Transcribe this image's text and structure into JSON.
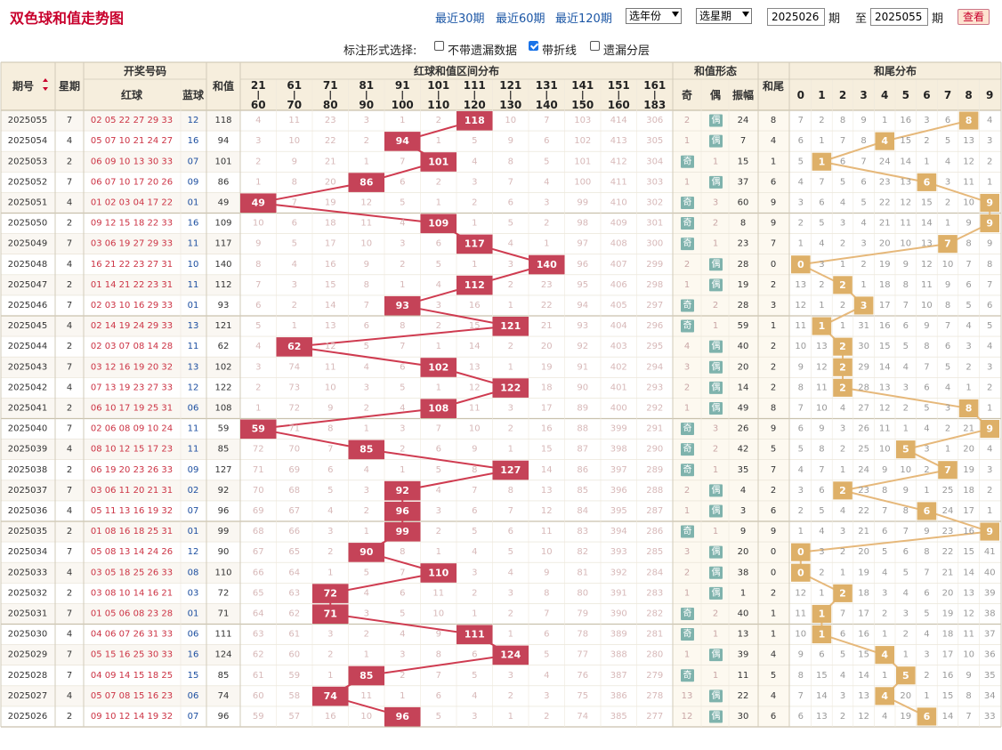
{
  "title": "双色球和值走势图",
  "ranges": [
    {
      "label": "最近30期",
      "active": true
    },
    {
      "label": "最近60期",
      "active": false
    },
    {
      "label": "最近120期",
      "active": false
    }
  ],
  "year_select": "选年份",
  "period_select": "选星期",
  "from_value": "2025026",
  "period_label": "期",
  "to_label": "至",
  "to_value": "2025055",
  "query_label": "查看",
  "options": {
    "label": "标注形式选择:",
    "items": [
      {
        "label": "不带遗漏数据",
        "checked": false
      },
      {
        "label": "带折线",
        "checked": true
      },
      {
        "label": "遗漏分层",
        "checked": false
      }
    ]
  },
  "headers": {
    "issue": "期号",
    "weekday": "星期",
    "draw": "开奖号码",
    "red": "红球",
    "blue": "蓝球",
    "sum": "和值",
    "range_dist": "红球和值区间分布",
    "form": "和值形态",
    "odd": "奇",
    "even": "偶",
    "amplitude": "振幅",
    "tail": "和尾",
    "tail_dist": "和尾分布"
  },
  "ranges_bins": [
    {
      "top": "21",
      "bottom": "60"
    },
    {
      "top": "61",
      "bottom": "70"
    },
    {
      "top": "71",
      "bottom": "80"
    },
    {
      "top": "81",
      "bottom": "90"
    },
    {
      "top": "91",
      "bottom": "100"
    },
    {
      "top": "101",
      "bottom": "110"
    },
    {
      "top": "111",
      "bottom": "120"
    },
    {
      "top": "121",
      "bottom": "130"
    },
    {
      "top": "131",
      "bottom": "140"
    },
    {
      "top": "141",
      "bottom": "150"
    },
    {
      "top": "151",
      "bottom": "160"
    },
    {
      "top": "161",
      "bottom": "183"
    }
  ],
  "tail_digits": [
    "0",
    "1",
    "2",
    "3",
    "4",
    "5",
    "6",
    "7",
    "8",
    "9"
  ],
  "odd_word": "奇",
  "even_word": "偶",
  "colors": {
    "red": "#cc3344",
    "blue": "#1d4fa0",
    "hit_red": "#c54358",
    "hit_tail": "#deb068",
    "line_red": "#cf3b50",
    "line_tail": "#e6b87a"
  },
  "rows": [
    {
      "issue": "2025055",
      "week": "7",
      "red": "02 05 22 27 29 33",
      "blue": "12",
      "sum": "118",
      "bins": [
        "4",
        "11",
        "23",
        "3",
        "1",
        "2",
        "118",
        "10",
        "7",
        "103",
        "414",
        "306"
      ],
      "odd": "2",
      "even": "偶",
      "amp": "24",
      "tail": "8",
      "tails": [
        "7",
        "2",
        "8",
        "9",
        "1",
        "16",
        "3",
        "6",
        "8",
        "4"
      ]
    },
    {
      "issue": "2025054",
      "week": "4",
      "red": "05 07 10 21 24 27",
      "blue": "16",
      "sum": "94",
      "bins": [
        "3",
        "10",
        "22",
        "2",
        "94",
        "1",
        "5",
        "9",
        "6",
        "102",
        "413",
        "305"
      ],
      "odd": "1",
      "even": "偶",
      "amp": "7",
      "tail": "4",
      "tails": [
        "6",
        "1",
        "7",
        "8",
        "4",
        "15",
        "2",
        "5",
        "13",
        "3"
      ]
    },
    {
      "issue": "2025053",
      "week": "2",
      "red": "06 09 10 13 30 33",
      "blue": "07",
      "sum": "101",
      "bins": [
        "2",
        "9",
        "21",
        "1",
        "7",
        "101",
        "4",
        "8",
        "5",
        "101",
        "412",
        "304"
      ],
      "odd": "奇",
      "even": "1",
      "amp": "15",
      "tail": "1",
      "tails": [
        "5",
        "1",
        "6",
        "7",
        "24",
        "14",
        "1",
        "4",
        "12",
        "2"
      ]
    },
    {
      "issue": "2025052",
      "week": "7",
      "red": "06 07 10 17 20 26",
      "blue": "09",
      "sum": "86",
      "bins": [
        "1",
        "8",
        "20",
        "86",
        "6",
        "2",
        "3",
        "7",
        "4",
        "100",
        "411",
        "303"
      ],
      "odd": "1",
      "even": "偶",
      "amp": "37",
      "tail": "6",
      "tails": [
        "4",
        "7",
        "5",
        "6",
        "23",
        "13",
        "6",
        "3",
        "11",
        "1"
      ]
    },
    {
      "issue": "2025051",
      "week": "4",
      "red": "01 02 03 04 17 22",
      "blue": "01",
      "sum": "49",
      "bins": [
        "49",
        "7",
        "19",
        "12",
        "5",
        "1",
        "2",
        "6",
        "3",
        "99",
        "410",
        "302"
      ],
      "odd": "奇",
      "even": "3",
      "amp": "60",
      "tail": "9",
      "tails": [
        "3",
        "6",
        "4",
        "5",
        "22",
        "12",
        "15",
        "2",
        "10",
        "9"
      ]
    },
    {
      "issue": "2025050",
      "week": "2",
      "red": "09 12 15 18 22 33",
      "blue": "16",
      "sum": "109",
      "bins": [
        "10",
        "6",
        "18",
        "11",
        "4",
        "109",
        "1",
        "5",
        "2",
        "98",
        "409",
        "301"
      ],
      "odd": "奇",
      "even": "2",
      "amp": "8",
      "tail": "9",
      "tails": [
        "2",
        "5",
        "3",
        "4",
        "21",
        "11",
        "14",
        "1",
        "9",
        "9"
      ]
    },
    {
      "issue": "2025049",
      "week": "7",
      "red": "03 06 19 27 29 33",
      "blue": "11",
      "sum": "117",
      "bins": [
        "9",
        "5",
        "17",
        "10",
        "3",
        "6",
        "117",
        "4",
        "1",
        "97",
        "408",
        "300"
      ],
      "odd": "奇",
      "even": "1",
      "amp": "23",
      "tail": "7",
      "tails": [
        "1",
        "4",
        "2",
        "3",
        "20",
        "10",
        "13",
        "7",
        "8",
        "9"
      ]
    },
    {
      "issue": "2025048",
      "week": "4",
      "red": "16 21 22 23 27 31",
      "blue": "10",
      "sum": "140",
      "bins": [
        "8",
        "4",
        "16",
        "9",
        "2",
        "5",
        "1",
        "3",
        "140",
        "96",
        "407",
        "299"
      ],
      "odd": "2",
      "even": "偶",
      "amp": "28",
      "tail": "0",
      "tails": [
        "0",
        "3",
        "1",
        "2",
        "19",
        "9",
        "12",
        "10",
        "7",
        "8"
      ]
    },
    {
      "issue": "2025047",
      "week": "2",
      "red": "01 14 21 22 23 31",
      "blue": "11",
      "sum": "112",
      "bins": [
        "7",
        "3",
        "15",
        "8",
        "1",
        "4",
        "112",
        "2",
        "23",
        "95",
        "406",
        "298"
      ],
      "odd": "1",
      "even": "偶",
      "amp": "19",
      "tail": "2",
      "tails": [
        "13",
        "2",
        "2",
        "1",
        "18",
        "8",
        "11",
        "9",
        "6",
        "7"
      ]
    },
    {
      "issue": "2025046",
      "week": "7",
      "red": "02 03 10 16 29 33",
      "blue": "01",
      "sum": "93",
      "bins": [
        "6",
        "2",
        "14",
        "7",
        "93",
        "3",
        "16",
        "1",
        "22",
        "94",
        "405",
        "297"
      ],
      "odd": "奇",
      "even": "2",
      "amp": "28",
      "tail": "3",
      "tails": [
        "12",
        "1",
        "2",
        "3",
        "17",
        "7",
        "10",
        "8",
        "5",
        "6"
      ]
    },
    {
      "issue": "2025045",
      "week": "4",
      "red": "02 14 19 24 29 33",
      "blue": "13",
      "sum": "121",
      "bins": [
        "5",
        "1",
        "13",
        "6",
        "8",
        "2",
        "15",
        "121",
        "21",
        "93",
        "404",
        "296"
      ],
      "odd": "奇",
      "even": "1",
      "amp": "59",
      "tail": "1",
      "tails": [
        "11",
        "1",
        "1",
        "31",
        "16",
        "6",
        "9",
        "7",
        "4",
        "5"
      ]
    },
    {
      "issue": "2025044",
      "week": "2",
      "red": "02 03 07 08 14 28",
      "blue": "11",
      "sum": "62",
      "bins": [
        "4",
        "62",
        "12",
        "5",
        "7",
        "1",
        "14",
        "2",
        "20",
        "92",
        "403",
        "295"
      ],
      "odd": "4",
      "even": "偶",
      "amp": "40",
      "tail": "2",
      "tails": [
        "10",
        "13",
        "2",
        "30",
        "15",
        "5",
        "8",
        "6",
        "3",
        "4"
      ]
    },
    {
      "issue": "2025043",
      "week": "7",
      "red": "03 12 16 19 20 32",
      "blue": "13",
      "sum": "102",
      "bins": [
        "3",
        "74",
        "11",
        "4",
        "6",
        "102",
        "13",
        "1",
        "19",
        "91",
        "402",
        "294"
      ],
      "odd": "3",
      "even": "偶",
      "amp": "20",
      "tail": "2",
      "tails": [
        "9",
        "12",
        "2",
        "29",
        "14",
        "4",
        "7",
        "5",
        "2",
        "3"
      ]
    },
    {
      "issue": "2025042",
      "week": "4",
      "red": "07 13 19 23 27 33",
      "blue": "12",
      "sum": "122",
      "bins": [
        "2",
        "73",
        "10",
        "3",
        "5",
        "1",
        "12",
        "122",
        "18",
        "90",
        "401",
        "293"
      ],
      "odd": "2",
      "even": "偶",
      "amp": "14",
      "tail": "2",
      "tails": [
        "8",
        "11",
        "2",
        "28",
        "13",
        "3",
        "6",
        "4",
        "1",
        "2"
      ]
    },
    {
      "issue": "2025041",
      "week": "2",
      "red": "06 10 17 19 25 31",
      "blue": "06",
      "sum": "108",
      "bins": [
        "1",
        "72",
        "9",
        "2",
        "4",
        "108",
        "11",
        "3",
        "17",
        "89",
        "400",
        "292"
      ],
      "odd": "1",
      "even": "偶",
      "amp": "49",
      "tail": "8",
      "tails": [
        "7",
        "10",
        "4",
        "27",
        "12",
        "2",
        "5",
        "3",
        "8",
        "1"
      ]
    },
    {
      "issue": "2025040",
      "week": "7",
      "red": "02 06 08 09 10 24",
      "blue": "11",
      "sum": "59",
      "bins": [
        "59",
        "71",
        "8",
        "1",
        "3",
        "7",
        "10",
        "2",
        "16",
        "88",
        "399",
        "291"
      ],
      "odd": "奇",
      "even": "3",
      "amp": "26",
      "tail": "9",
      "tails": [
        "6",
        "9",
        "3",
        "26",
        "11",
        "1",
        "4",
        "2",
        "21",
        "9"
      ]
    },
    {
      "issue": "2025039",
      "week": "4",
      "red": "08 10 12 15 17 23",
      "blue": "11",
      "sum": "85",
      "bins": [
        "72",
        "70",
        "7",
        "85",
        "2",
        "6",
        "9",
        "1",
        "15",
        "87",
        "398",
        "290"
      ],
      "odd": "奇",
      "even": "2",
      "amp": "42",
      "tail": "5",
      "tails": [
        "5",
        "8",
        "2",
        "25",
        "10",
        "5",
        "3",
        "1",
        "20",
        "4"
      ]
    },
    {
      "issue": "2025038",
      "week": "2",
      "red": "06 19 20 23 26 33",
      "blue": "09",
      "sum": "127",
      "bins": [
        "71",
        "69",
        "6",
        "4",
        "1",
        "5",
        "8",
        "127",
        "14",
        "86",
        "397",
        "289"
      ],
      "odd": "奇",
      "even": "1",
      "amp": "35",
      "tail": "7",
      "tails": [
        "4",
        "7",
        "1",
        "24",
        "9",
        "10",
        "2",
        "7",
        "19",
        "3"
      ]
    },
    {
      "issue": "2025037",
      "week": "7",
      "red": "03 06 11 20 21 31",
      "blue": "02",
      "sum": "92",
      "bins": [
        "70",
        "68",
        "5",
        "3",
        "92",
        "4",
        "7",
        "8",
        "13",
        "85",
        "396",
        "288"
      ],
      "odd": "2",
      "even": "偶",
      "amp": "4",
      "tail": "2",
      "tails": [
        "3",
        "6",
        "2",
        "23",
        "8",
        "9",
        "1",
        "25",
        "18",
        "2"
      ]
    },
    {
      "issue": "2025036",
      "week": "4",
      "red": "05 11 13 16 19 32",
      "blue": "07",
      "sum": "96",
      "bins": [
        "69",
        "67",
        "4",
        "2",
        "96",
        "3",
        "6",
        "7",
        "12",
        "84",
        "395",
        "287"
      ],
      "odd": "1",
      "even": "偶",
      "amp": "3",
      "tail": "6",
      "tails": [
        "2",
        "5",
        "4",
        "22",
        "7",
        "8",
        "6",
        "24",
        "17",
        "1"
      ]
    },
    {
      "issue": "2025035",
      "week": "2",
      "red": "01 08 16 18 25 31",
      "blue": "01",
      "sum": "99",
      "bins": [
        "68",
        "66",
        "3",
        "1",
        "99",
        "2",
        "5",
        "6",
        "11",
        "83",
        "394",
        "286"
      ],
      "odd": "奇",
      "even": "1",
      "amp": "9",
      "tail": "9",
      "tails": [
        "1",
        "4",
        "3",
        "21",
        "6",
        "7",
        "9",
        "23",
        "16",
        "9"
      ]
    },
    {
      "issue": "2025034",
      "week": "7",
      "red": "05 08 13 14 24 26",
      "blue": "12",
      "sum": "90",
      "bins": [
        "67",
        "65",
        "2",
        "90",
        "8",
        "1",
        "4",
        "5",
        "10",
        "82",
        "393",
        "285"
      ],
      "odd": "3",
      "even": "偶",
      "amp": "20",
      "tail": "0",
      "tails": [
        "0",
        "3",
        "2",
        "20",
        "5",
        "6",
        "8",
        "22",
        "15",
        "41"
      ]
    },
    {
      "issue": "2025033",
      "week": "4",
      "red": "03 05 18 25 26 33",
      "blue": "08",
      "sum": "110",
      "bins": [
        "66",
        "64",
        "1",
        "5",
        "7",
        "110",
        "3",
        "4",
        "9",
        "81",
        "392",
        "284"
      ],
      "odd": "2",
      "even": "偶",
      "amp": "38",
      "tail": "0",
      "tails": [
        "0",
        "2",
        "1",
        "19",
        "4",
        "5",
        "7",
        "21",
        "14",
        "40"
      ]
    },
    {
      "issue": "2025032",
      "week": "2",
      "red": "03 08 10 14 16 21",
      "blue": "03",
      "sum": "72",
      "bins": [
        "65",
        "63",
        "72",
        "4",
        "6",
        "11",
        "2",
        "3",
        "8",
        "80",
        "391",
        "283"
      ],
      "odd": "1",
      "even": "偶",
      "amp": "1",
      "tail": "2",
      "tails": [
        "12",
        "1",
        "2",
        "18",
        "3",
        "4",
        "6",
        "20",
        "13",
        "39"
      ]
    },
    {
      "issue": "2025031",
      "week": "7",
      "red": "01 05 06 08 23 28",
      "blue": "01",
      "sum": "71",
      "bins": [
        "64",
        "62",
        "71",
        "3",
        "5",
        "10",
        "1",
        "2",
        "7",
        "79",
        "390",
        "282"
      ],
      "odd": "奇",
      "even": "2",
      "amp": "40",
      "tail": "1",
      "tails": [
        "11",
        "1",
        "7",
        "17",
        "2",
        "3",
        "5",
        "19",
        "12",
        "38"
      ]
    },
    {
      "issue": "2025030",
      "week": "4",
      "red": "04 06 07 26 31 33",
      "blue": "06",
      "sum": "111",
      "bins": [
        "63",
        "61",
        "3",
        "2",
        "4",
        "9",
        "111",
        "1",
        "6",
        "78",
        "389",
        "281"
      ],
      "odd": "奇",
      "even": "1",
      "amp": "13",
      "tail": "1",
      "tails": [
        "10",
        "1",
        "6",
        "16",
        "1",
        "2",
        "4",
        "18",
        "11",
        "37"
      ]
    },
    {
      "issue": "2025029",
      "week": "7",
      "red": "05 15 16 25 30 33",
      "blue": "16",
      "sum": "124",
      "bins": [
        "62",
        "60",
        "2",
        "1",
        "3",
        "8",
        "6",
        "124",
        "5",
        "77",
        "388",
        "280"
      ],
      "odd": "1",
      "even": "偶",
      "amp": "39",
      "tail": "4",
      "tails": [
        "9",
        "6",
        "5",
        "15",
        "4",
        "1",
        "3",
        "17",
        "10",
        "36"
      ]
    },
    {
      "issue": "2025028",
      "week": "7",
      "red": "04 09 14 15 18 25",
      "blue": "15",
      "sum": "85",
      "bins": [
        "61",
        "59",
        "1",
        "85",
        "2",
        "7",
        "5",
        "3",
        "4",
        "76",
        "387",
        "279"
      ],
      "odd": "奇",
      "even": "1",
      "amp": "11",
      "tail": "5",
      "tails": [
        "8",
        "15",
        "4",
        "14",
        "1",
        "5",
        "2",
        "16",
        "9",
        "35"
      ]
    },
    {
      "issue": "2025027",
      "week": "4",
      "red": "05 07 08 15 16 23",
      "blue": "06",
      "sum": "74",
      "bins": [
        "60",
        "58",
        "74",
        "11",
        "1",
        "6",
        "4",
        "2",
        "3",
        "75",
        "386",
        "278"
      ],
      "odd": "13",
      "even": "偶",
      "amp": "22",
      "tail": "4",
      "tails": [
        "7",
        "14",
        "3",
        "13",
        "4",
        "20",
        "1",
        "15",
        "8",
        "34"
      ]
    },
    {
      "issue": "2025026",
      "week": "2",
      "red": "09 10 12 14 19 32",
      "blue": "07",
      "sum": "96",
      "bins": [
        "59",
        "57",
        "16",
        "10",
        "96",
        "5",
        "3",
        "1",
        "2",
        "74",
        "385",
        "277"
      ],
      "odd": "12",
      "even": "偶",
      "amp": "30",
      "tail": "6",
      "tails": [
        "6",
        "13",
        "2",
        "12",
        "4",
        "19",
        "6",
        "14",
        "7",
        "33"
      ]
    }
  ]
}
